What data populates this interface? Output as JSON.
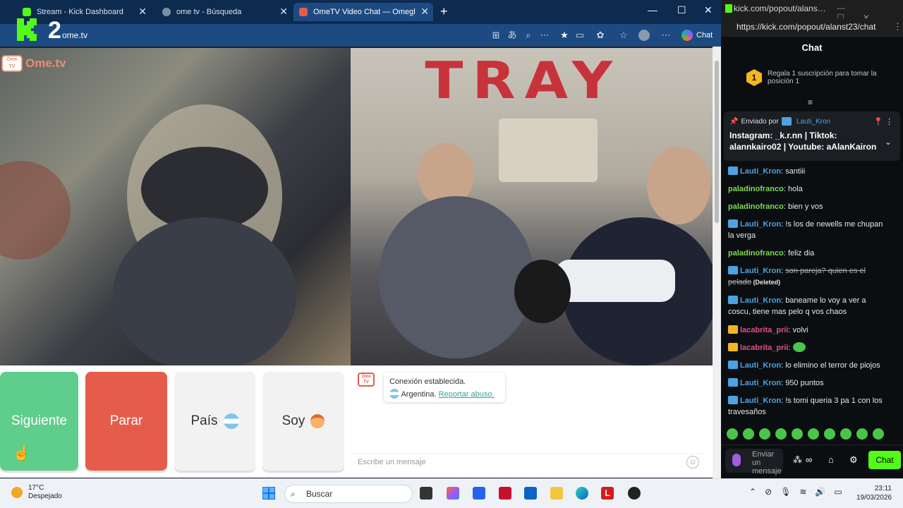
{
  "browser": {
    "tabs": [
      {
        "label": "Stream - Kick Dashboard",
        "color": "#53fc18"
      },
      {
        "label": "ome tv - Búsqueda",
        "color": "#7a8ea8"
      },
      {
        "label": "OmeTV Video Chat — Omegl",
        "color": "#e55d4a"
      }
    ],
    "url": "ome.tv",
    "chat_label": "Chat",
    "overlay_number": "2"
  },
  "ometv": {
    "logo_box": "Ome TV",
    "logo_text": "Ome.tv",
    "buttons": {
      "next": "Siguiente",
      "stop": "Parar",
      "country": "País",
      "me": "Soy"
    },
    "system_msg": {
      "line1": "Conexión establecida.",
      "country": "Argentina.",
      "report": "Reportar abuso."
    },
    "message_placeholder": "Escribe un mensaje",
    "graffiti": "TRAY",
    "accent_next": "#5fcd8c",
    "accent_stop": "#e55d4a"
  },
  "kick": {
    "window_title": "kick.com/popout/alans…",
    "url": "https://kick.com/popout/alanst23/chat",
    "chat_title": "Chat",
    "sub_promo": {
      "rank": "1",
      "text": "Regala 1 suscripción para tomar la posición 1"
    },
    "pinned": {
      "label": "Enviado por",
      "user": "Lauti_Kron",
      "text": "Instagram: _k.r.nn | Tiktok: alannkairo02 | Youtube: aAlanKairon"
    },
    "messages": [
      {
        "user": "Lauti_Kron",
        "badge": "mod",
        "color": "#4ba3e3",
        "text": "santiii"
      },
      {
        "user": "paladinofranco",
        "badge": "",
        "color": "#7ed957",
        "text": "hola"
      },
      {
        "user": "paladinofranco",
        "badge": "",
        "color": "#7ed957",
        "text": "bien y vos"
      },
      {
        "user": "Lauti_Kron",
        "badge": "mod",
        "color": "#4ba3e3",
        "text": "!s los de newells me chupan la verga"
      },
      {
        "user": "paladinofranco",
        "badge": "",
        "color": "#7ed957",
        "text": "feliz dia"
      },
      {
        "user": "Lauti_Kron",
        "badge": "mod",
        "color": "#4ba3e3",
        "text": "son pareja? quien es el pelado",
        "deleted": "(Deleted)"
      },
      {
        "user": "Lauti_Kron",
        "badge": "mod",
        "color": "#4ba3e3",
        "text": "baneame lo voy a ver a coscu, tiene mas pelo q vos chaos"
      },
      {
        "user": "lacabrita_prii",
        "badge": "crown",
        "color": "#e0508a",
        "text": "volvi"
      },
      {
        "user": "lacabrita_prii",
        "badge": "crown",
        "color": "#e0508a",
        "text": ""
      },
      {
        "user": "Lauti_Kron",
        "badge": "mod",
        "color": "#4ba3e3",
        "text": "lo elimino el terror de piojos"
      },
      {
        "user": "Lauti_Kron",
        "badge": "mod",
        "color": "#4ba3e3",
        "text": "950 puntos"
      },
      {
        "user": "Lauti_Kron",
        "badge": "mod",
        "color": "#4ba3e3",
        "text": "!s tomi queria 3 pa 1 con los travesaños"
      }
    ],
    "input_placeholder": "Enviar un mensaje",
    "send_label": "Chat",
    "brand_color": "#53fc18"
  },
  "taskbar": {
    "weather_temp": "17°C",
    "weather_desc": "Despejado",
    "search": "Buscar",
    "time": "23:11",
    "date": "19/03/2026"
  }
}
